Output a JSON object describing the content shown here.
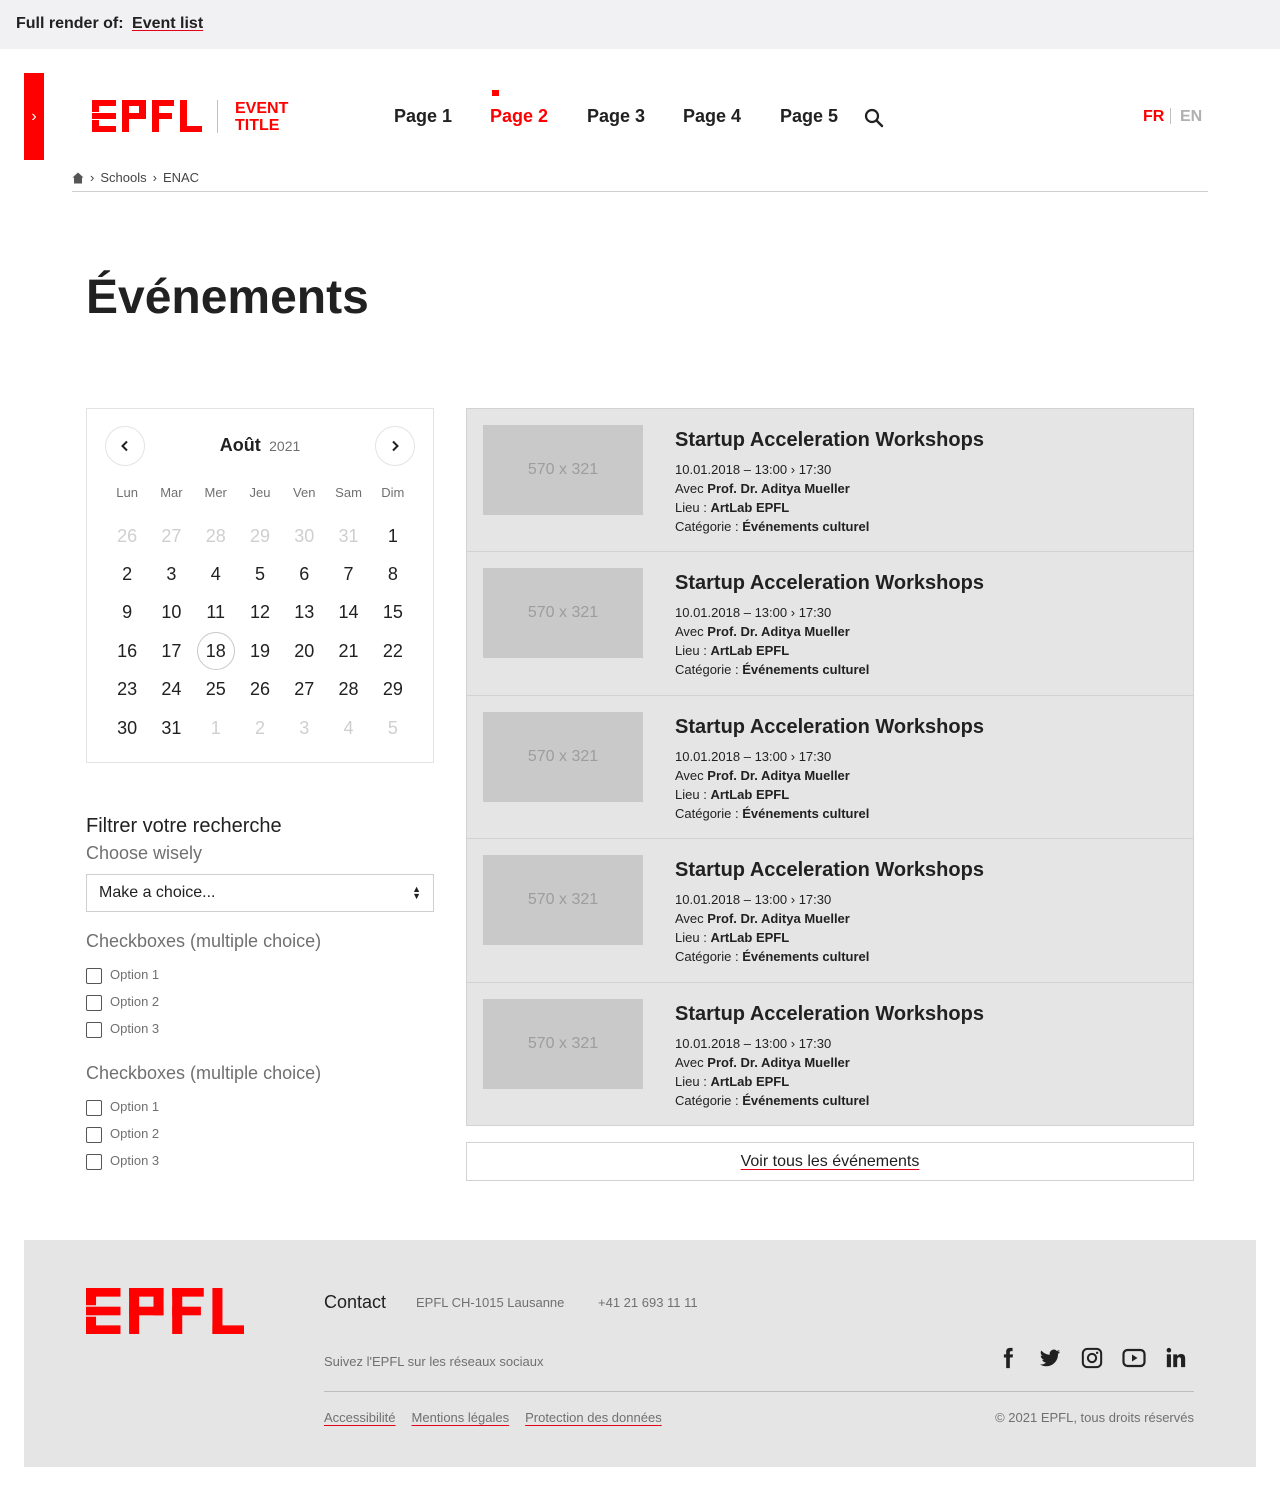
{
  "renderbar": {
    "prefix": "Full render of:",
    "link": "Event list"
  },
  "header": {
    "event_title": "EVENT TITLE",
    "nav": [
      {
        "label": "Page 1",
        "active": false
      },
      {
        "label": "Page 2",
        "active": true
      },
      {
        "label": "Page 3",
        "active": false
      },
      {
        "label": "Page 4",
        "active": false
      },
      {
        "label": "Page 5",
        "active": false
      }
    ],
    "lang_fr": "FR",
    "lang_en": "EN"
  },
  "breadcrumb": {
    "items": [
      "Schools",
      "ENAC"
    ],
    "separator": "›"
  },
  "page_title": "Événements",
  "calendar": {
    "month": "Août",
    "year": "2021",
    "dows": [
      "Lun",
      "Mar",
      "Mer",
      "Jeu",
      "Ven",
      "Sam",
      "Dim"
    ],
    "weeks": [
      [
        "26",
        "27",
        "28",
        "29",
        "30",
        "31",
        "1"
      ],
      [
        "2",
        "3",
        "4",
        "5",
        "6",
        "7",
        "8"
      ],
      [
        "9",
        "10",
        "11",
        "12",
        "13",
        "14",
        "15"
      ],
      [
        "16",
        "17",
        "18",
        "19",
        "20",
        "21",
        "22"
      ],
      [
        "23",
        "24",
        "25",
        "26",
        "27",
        "28",
        "29"
      ],
      [
        "30",
        "31",
        "1",
        "2",
        "3",
        "4",
        "5"
      ]
    ],
    "today": "18"
  },
  "filters": {
    "title": "Filtrer votre recherche",
    "subtitle": "Choose wisely",
    "select_value": "Make a choice...",
    "groups": [
      {
        "title": "Checkboxes (multiple choice)",
        "options": [
          "Option 1",
          "Option 2",
          "Option 3"
        ]
      },
      {
        "title": "Checkboxes (multiple choice)",
        "options": [
          "Option 1",
          "Option 2",
          "Option 3"
        ]
      }
    ]
  },
  "events": [
    {
      "thumb": "570 x 321",
      "title": "Startup Acceleration Workshops",
      "date": "10.01.2018",
      "dash": "–",
      "start": "13:00",
      "arrow": "›",
      "end": "17:30",
      "with_label": "Avec",
      "speaker": "Prof. Dr. Aditya Mueller",
      "place_label": "Lieu :",
      "place": "ArtLab EPFL",
      "cat_label": "Catégorie :",
      "category": "Événements culturel"
    },
    {
      "thumb": "570 x 321",
      "title": "Startup Acceleration Workshops",
      "date": "10.01.2018",
      "dash": "–",
      "start": "13:00",
      "arrow": "›",
      "end": "17:30",
      "with_label": "Avec",
      "speaker": "Prof. Dr. Aditya Mueller",
      "place_label": "Lieu :",
      "place": "ArtLab EPFL",
      "cat_label": "Catégorie :",
      "category": "Événements culturel"
    },
    {
      "thumb": "570 x 321",
      "title": "Startup Acceleration Workshops",
      "date": "10.01.2018",
      "dash": "–",
      "start": "13:00",
      "arrow": "›",
      "end": "17:30",
      "with_label": "Avec",
      "speaker": "Prof. Dr. Aditya Mueller",
      "place_label": "Lieu :",
      "place": "ArtLab EPFL",
      "cat_label": "Catégorie :",
      "category": "Événements culturel"
    },
    {
      "thumb": "570 x 321",
      "title": "Startup Acceleration Workshops",
      "date": "10.01.2018",
      "dash": "–",
      "start": "13:00",
      "arrow": "›",
      "end": "17:30",
      "with_label": "Avec",
      "speaker": "Prof. Dr. Aditya Mueller",
      "place_label": "Lieu :",
      "place": "ArtLab EPFL",
      "cat_label": "Catégorie :",
      "category": "Événements culturel"
    },
    {
      "thumb": "570 x 321",
      "title": "Startup Acceleration Workshops",
      "date": "10.01.2018",
      "dash": "–",
      "start": "13:00",
      "arrow": "›",
      "end": "17:30",
      "with_label": "Avec",
      "speaker": "Prof. Dr. Aditya Mueller",
      "place_label": "Lieu :",
      "place": "ArtLab EPFL",
      "cat_label": "Catégorie :",
      "category": "Événements culturel"
    }
  ],
  "all_events_label": "Voir tous les événements",
  "footer": {
    "contact": "Contact",
    "address": "EPFL CH-1015 Lausanne",
    "phone": "+41 21 693 11 11",
    "social_text": "Suivez l'EPFL sur les réseaux sociaux",
    "socials": [
      "facebook-icon",
      "twitter-icon",
      "instagram-icon",
      "youtube-icon",
      "linkedin-icon"
    ],
    "links": [
      "Accessibilité",
      "Mentions légales",
      "Protection des données"
    ],
    "copyright": "© 2021 EPFL, tous droits réservés"
  },
  "colors": {
    "brand_red": "#ff0000",
    "panel_grey": "#e5e5e5",
    "text": "#212121",
    "muted": "#707070"
  }
}
